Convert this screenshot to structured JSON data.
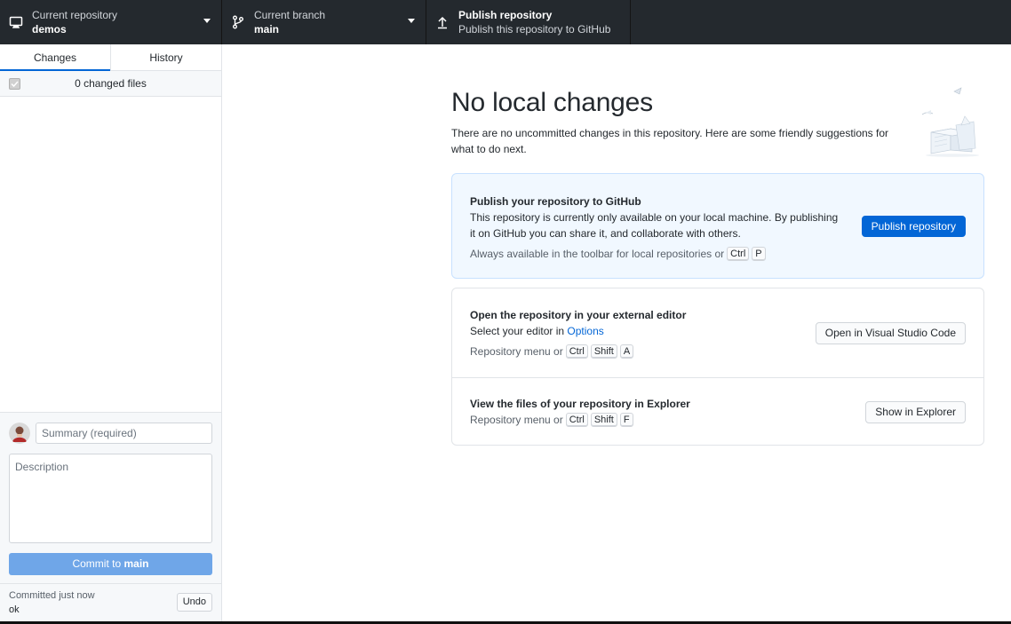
{
  "toolbar": {
    "repo": {
      "title": "Current repository",
      "value": "demos",
      "icon": "monitor-icon"
    },
    "branch": {
      "title": "Current branch",
      "value": "main",
      "icon": "git-branch-icon"
    },
    "publish": {
      "title": "Publish repository",
      "value": "Publish this repository to GitHub",
      "icon": "upload-icon"
    }
  },
  "sidebar": {
    "tabs": [
      {
        "label": "Changes",
        "active": true
      },
      {
        "label": "History",
        "active": false
      }
    ],
    "changed_files": "0 changed files",
    "commit": {
      "summary_placeholder": "Summary (required)",
      "description_placeholder": "Description",
      "button_prefix": "Commit to",
      "button_branch": "main"
    },
    "undo": {
      "status": "Committed just now",
      "message": "ok",
      "button": "Undo"
    }
  },
  "main": {
    "title": "No local changes",
    "description": "There are no uncommitted changes in this repository. Here are some friendly suggestions for what to do next.",
    "publish_card": {
      "title": "Publish your repository to GitHub",
      "text": "This repository is currently only available on your local machine. By publishing it on GitHub you can share it, and collaborate with others.",
      "hint": "Always available in the toolbar for local repositories or",
      "keys": [
        "Ctrl",
        "P"
      ],
      "button": "Publish repository"
    },
    "editor_card": {
      "title": "Open the repository in your external editor",
      "text_prefix": "Select your editor in",
      "text_link": "Options",
      "hint": "Repository menu or",
      "keys": [
        "Ctrl",
        "Shift",
        "A"
      ],
      "button": "Open in Visual Studio Code"
    },
    "explorer_card": {
      "title": "View the files of your repository in Explorer",
      "hint": "Repository menu or",
      "keys": [
        "Ctrl",
        "Shift",
        "F"
      ],
      "button": "Show in Explorer"
    }
  },
  "colors": {
    "toolbar_bg": "#24292e",
    "accent": "#0366d6",
    "commit_button": "#6fa6e8",
    "publish_card_bg": "#f1f8ff"
  }
}
